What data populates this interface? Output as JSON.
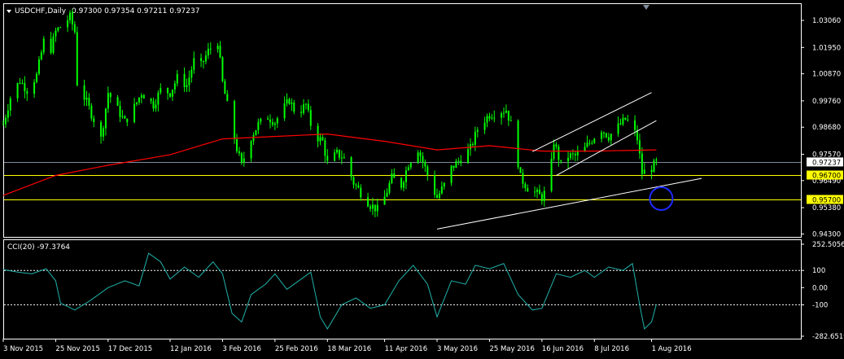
{
  "header": {
    "symbol": "USDCHF,Daily",
    "ohlc": "0.97300 0.97354 0.97211 0.97237",
    "indicator": "CCI(20) -97.3764"
  },
  "colors": {
    "background": "#000000",
    "candle": "#00ff00",
    "ma": "#ff0000",
    "cci": "#20b2aa",
    "level_line": "#ffff00",
    "trend_line": "#ffffff",
    "marker_circle": "#1e2aff"
  },
  "chart_data": [
    {
      "type": "candlestick",
      "title": "USDCHF,Daily",
      "ylim": [
        0.9418,
        1.0373
      ],
      "y_ticks": [
        "1.03060",
        "1.01950",
        "1.00870",
        "0.99760",
        "0.98680",
        "0.97570",
        "0.96490",
        "0.95380",
        "0.94300"
      ],
      "x_tick_labels": [
        "3 Nov 2015",
        "25 Nov 2015",
        "17 Dec 2015",
        "12 Jan 2016",
        "3 Feb 2016",
        "25 Feb 2016",
        "18 Mar 2016",
        "11 Apr 2016",
        "3 May 2016",
        "25 May 2016",
        "16 Jun 2016",
        "8 Jul 2016",
        "1 Aug 2016"
      ],
      "current_price": "0.97237",
      "levels": [
        {
          "label": "0.96700",
          "value": 0.967
        },
        {
          "label": "0.95700",
          "value": 0.957
        }
      ],
      "close_path": [
        [
          "3 Nov 2015",
          0.988
        ],
        [
          "6 Nov 2015",
          0.999
        ],
        [
          "10 Nov 2015",
          1.006
        ],
        [
          "13 Nov 2015",
          1.002
        ],
        [
          "17 Nov 2015",
          1.008
        ],
        [
          "20 Nov 2015",
          1.022
        ],
        [
          "23 Nov 2015",
          1.019
        ],
        [
          "25 Nov 2015",
          1.026
        ],
        [
          "28 Nov 2015",
          1.029
        ],
        [
          "1 Dec 2015",
          1.032
        ],
        [
          "3 Dec 2015",
          1.026
        ],
        [
          "4 Dec 2015",
          1.005
        ],
        [
          "8 Dec 2015",
          0.997
        ],
        [
          "11 Dec 2015",
          0.99
        ],
        [
          "14 Dec 2015",
          0.982
        ],
        [
          "17 Dec 2015",
          1.001
        ],
        [
          "21 Dec 2015",
          0.994
        ],
        [
          "24 Dec 2015",
          0.989
        ],
        [
          "28 Dec 2015",
          0.995
        ],
        [
          "31 Dec 2015",
          1.001
        ],
        [
          "5 Jan 2016",
          0.996
        ],
        [
          "8 Jan 2016",
          1.002
        ],
        [
          "12 Jan 2016",
          1.001
        ],
        [
          "15 Jan 2016",
          1.007
        ],
        [
          "19 Jan 2016",
          1.004
        ],
        [
          "22 Jan 2016",
          1.014
        ],
        [
          "25 Jan 2016",
          1.012
        ],
        [
          "28 Jan 2016",
          1.018
        ],
        [
          "1 Feb 2016",
          1.022
        ],
        [
          "3 Feb 2016",
          1.005
        ],
        [
          "6 Feb 2016",
          0.991
        ],
        [
          "9 Feb 2016",
          0.978
        ],
        [
          "11 Feb 2016",
          0.971
        ],
        [
          "14 Feb 2016",
          0.981
        ],
        [
          "18 Feb 2016",
          0.988
        ],
        [
          "22 Feb 2016",
          0.991
        ],
        [
          "25 Feb 2016",
          0.989
        ],
        [
          "29 Feb 2016",
          0.995
        ],
        [
          "2 Mar 2016",
          0.998
        ],
        [
          "5 Mar 2016",
          0.992
        ],
        [
          "9 Mar 2016",
          0.996
        ],
        [
          "12 Mar 2016",
          0.984
        ],
        [
          "16 Mar 2016",
          0.981
        ],
        [
          "18 Mar 2016",
          0.972
        ],
        [
          "22 Mar 2016",
          0.976
        ],
        [
          "25 Mar 2016",
          0.974
        ],
        [
          "29 Mar 2016",
          0.964
        ],
        [
          "1 Apr 2016",
          0.96
        ],
        [
          "5 Apr 2016",
          0.955
        ],
        [
          "8 Apr 2016",
          0.953
        ],
        [
          "11 Apr 2016",
          0.958
        ],
        [
          "14 Apr 2016",
          0.966
        ],
        [
          "18 Apr 2016",
          0.963
        ],
        [
          "21 Apr 2016",
          0.972
        ],
        [
          "25 Apr 2016",
          0.978
        ],
        [
          "28 Apr 2016",
          0.97
        ],
        [
          "1 May 2016",
          0.962
        ],
        [
          "3 May 2016",
          0.958
        ],
        [
          "6 May 2016",
          0.963
        ],
        [
          "9 May 2016",
          0.97
        ],
        [
          "13 May 2016",
          0.974
        ],
        [
          "17 May 2016",
          0.978
        ],
        [
          "20 May 2016",
          0.986
        ],
        [
          "23 May 2016",
          0.99
        ],
        [
          "25 May 2016",
          0.992
        ],
        [
          "28 May 2016",
          0.993
        ],
        [
          "1 Jun 2016",
          0.994
        ],
        [
          "4 Jun 2016",
          0.985
        ],
        [
          "7 Jun 2016",
          0.966
        ],
        [
          "10 Jun 2016",
          0.962
        ],
        [
          "13 Jun 2016",
          0.96
        ],
        [
          "16 Jun 2016",
          0.958
        ],
        [
          "19 Jun 2016",
          0.963
        ],
        [
          "21 Jun 2016",
          0.981
        ],
        [
          "24 Jun 2016",
          0.971
        ],
        [
          "27 Jun 2016",
          0.975
        ],
        [
          "30 Jun 2016",
          0.975
        ],
        [
          "4 Jul 2016",
          0.978
        ],
        [
          "8 Jul 2016",
          0.983
        ],
        [
          "11 Jul 2016",
          0.986
        ],
        [
          "14 Jul 2016",
          0.983
        ],
        [
          "18 Jul 2016",
          0.987
        ],
        [
          "21 Jul 2016",
          0.99
        ],
        [
          "24 Jul 2016",
          0.987
        ],
        [
          "26 Jul 2016",
          0.982
        ],
        [
          "28 Jul 2016",
          0.968
        ],
        [
          "1 Aug 2016",
          0.97
        ],
        [
          "3 Aug 2016",
          0.9724
        ]
      ],
      "moving_average": [
        [
          "3 Nov 2015",
          0.9588
        ],
        [
          "25 Nov 2015",
          0.967
        ],
        [
          "17 Dec 2015",
          0.9712
        ],
        [
          "12 Jan 2016",
          0.9755
        ],
        [
          "3 Feb 2016",
          0.982
        ],
        [
          "25 Feb 2016",
          0.983
        ],
        [
          "18 Mar 2016",
          0.984
        ],
        [
          "11 Apr 2016",
          0.981
        ],
        [
          "3 May 2016",
          0.9775
        ],
        [
          "25 May 2016",
          0.9792
        ],
        [
          "16 Jun 2016",
          0.977
        ],
        [
          "8 Jul 2016",
          0.977
        ],
        [
          "3 Aug 2016",
          0.9775
        ]
      ],
      "trend_lines": [
        {
          "from": [
            "3 May 2016",
            0.945
          ],
          "to": [
            "22 Aug 2016",
            0.9658
          ]
        },
        {
          "from": [
            "12 Jun 2016",
            0.9768
          ],
          "to": [
            "1 Aug 2016",
            1.001
          ]
        },
        {
          "from": [
            "22 Jun 2016",
            0.967
          ],
          "to": [
            "3 Aug 2016",
            0.9895
          ]
        }
      ],
      "marker": {
        "x": "3 Aug 2016",
        "y": 0.9575,
        "shape": "circle"
      },
      "legend": "none",
      "grid": false
    },
    {
      "type": "line",
      "title": "CCI(20) -97.3764",
      "ylim": [
        -282.6519,
        252.5056
      ],
      "y_ticks": [
        "252.5056",
        "100",
        "0.00",
        "-100",
        "-282.6519"
      ],
      "dashed_levels": [
        100,
        -100
      ],
      "series": [
        {
          "values": [
            [
              "3 Nov 2015",
              105
            ],
            [
              "9 Nov 2015",
              90
            ],
            [
              "15 Nov 2015",
              80
            ],
            [
              "21 Nov 2015",
              110
            ],
            [
              "25 Nov 2015",
              40
            ],
            [
              "27 Nov 2015",
              -90
            ],
            [
              "3 Dec 2015",
              -130
            ],
            [
              "9 Dec 2015",
              -80
            ],
            [
              "17 Dec 2015",
              0
            ],
            [
              "24 Dec 2015",
              40
            ],
            [
              "30 Dec 2015",
              10
            ],
            [
              "3 Jan 2016",
              200
            ],
            [
              "8 Jan 2016",
              150
            ],
            [
              "12 Jan 2016",
              50
            ],
            [
              "18 Jan 2016",
              120
            ],
            [
              "24 Jan 2016",
              60
            ],
            [
              "30 Jan 2016",
              150
            ],
            [
              "3 Feb 2016",
              80
            ],
            [
              "7 Feb 2016",
              -150
            ],
            [
              "11 Feb 2016",
              -200
            ],
            [
              "15 Feb 2016",
              -40
            ],
            [
              "21 Feb 2016",
              20
            ],
            [
              "25 Feb 2016",
              80
            ],
            [
              "1 Mar 2016",
              -10
            ],
            [
              "7 Mar 2016",
              50
            ],
            [
              "11 Mar 2016",
              90
            ],
            [
              "15 Mar 2016",
              -170
            ],
            [
              "18 Mar 2016",
              -240
            ],
            [
              "24 Mar 2016",
              -100
            ],
            [
              "30 Mar 2016",
              -60
            ],
            [
              "5 Apr 2016",
              -120
            ],
            [
              "11 Apr 2016",
              -100
            ],
            [
              "17 Apr 2016",
              40
            ],
            [
              "23 Apr 2016",
              130
            ],
            [
              "29 Apr 2016",
              20
            ],
            [
              "3 May 2016",
              -170
            ],
            [
              "9 May 2016",
              40
            ],
            [
              "15 May 2016",
              20
            ],
            [
              "19 May 2016",
              130
            ],
            [
              "25 May 2016",
              110
            ],
            [
              "31 May 2016",
              140
            ],
            [
              "6 Jun 2016",
              -40
            ],
            [
              "12 Jun 2016",
              -130
            ],
            [
              "16 Jun 2016",
              -120
            ],
            [
              "22 Jun 2016",
              80
            ],
            [
              "28 Jun 2016",
              60
            ],
            [
              "4 Jul 2016",
              100
            ],
            [
              "8 Jul 2016",
              60
            ],
            [
              "14 Jul 2016",
              120
            ],
            [
              "20 Jul 2016",
              100
            ],
            [
              "24 Jul 2016",
              140
            ],
            [
              "27 Jul 2016",
              -100
            ],
            [
              "29 Jul 2016",
              -240
            ],
            [
              "1 Aug 2016",
              -200
            ],
            [
              "3 Aug 2016",
              -97.3764
            ]
          ]
        }
      ],
      "legend": "none",
      "grid": false
    }
  ]
}
